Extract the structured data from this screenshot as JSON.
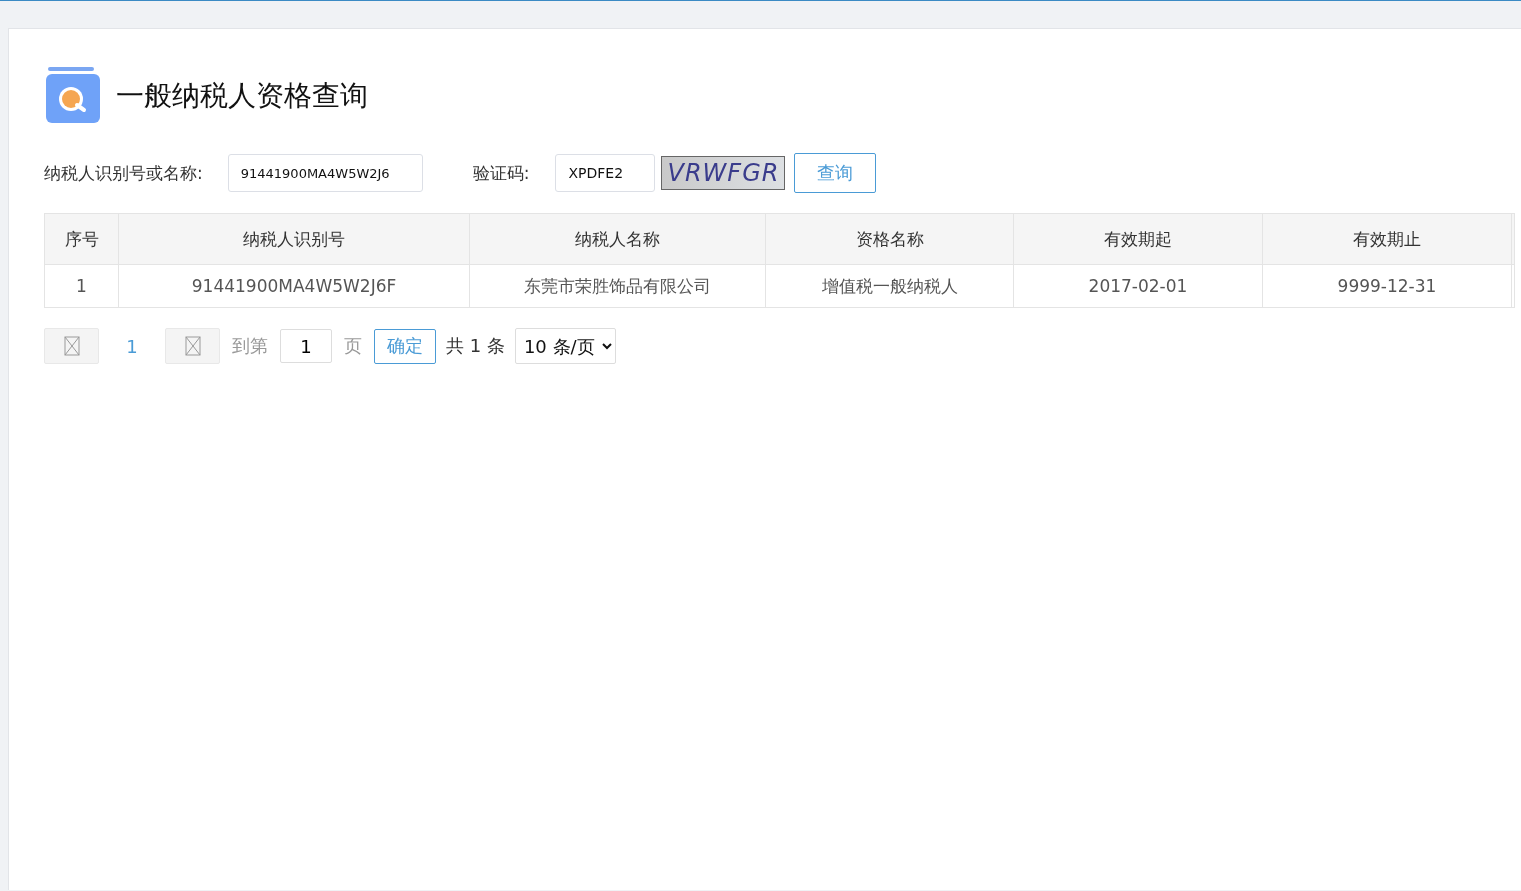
{
  "title": "一般纳税人资格查询",
  "search": {
    "id_label": "纳税人识别号或名称:",
    "id_value": "91441900MA4W5W2J6",
    "code_label": "验证码:",
    "code_value": "XPDFE2",
    "captcha": "VRWFGR",
    "button": "查询"
  },
  "table": {
    "columns": [
      "序号",
      "纳税人识别号",
      "纳税人名称",
      "资格名称",
      "有效期起",
      "有效期止"
    ],
    "rows": [
      [
        "1",
        "91441900MA4W5W2J6F",
        "东莞市荣胜饰品有限公司",
        "增值税一般纳税人",
        "2017-02-01",
        "9999-12-31"
      ]
    ]
  },
  "pagination": {
    "pages": [
      {
        "label": "1",
        "selected": true
      }
    ],
    "goto_label": "到第",
    "goto_value": "1",
    "page_unit": "页",
    "confirm": "确定",
    "total": "共 1 条",
    "page_size": "10 条/页"
  }
}
